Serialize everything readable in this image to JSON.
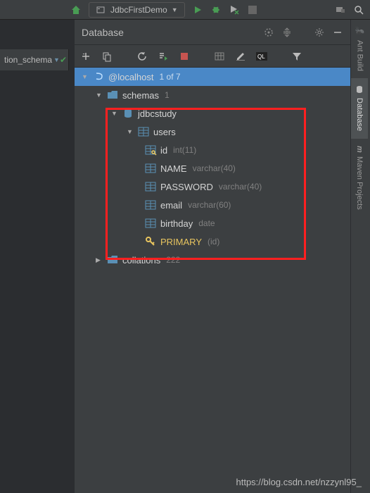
{
  "project_name": "JdbcFirstDemo",
  "left_stub": "tion_schema",
  "panel": {
    "title": "Database"
  },
  "root": {
    "label": "@localhost",
    "count": "1 of 7"
  },
  "schemas": {
    "label": "schemas",
    "count": "1"
  },
  "db": {
    "label": "jdbcstudy"
  },
  "table": {
    "label": "users"
  },
  "columns": [
    {
      "name": "id",
      "type": "int(11)",
      "pk": true
    },
    {
      "name": "NAME",
      "type": "varchar(40)",
      "pk": false
    },
    {
      "name": "PASSWORD",
      "type": "varchar(40)",
      "pk": false
    },
    {
      "name": "email",
      "type": "varchar(60)",
      "pk": false
    },
    {
      "name": "birthday",
      "type": "date",
      "pk": false
    }
  ],
  "primary": {
    "label": "PRIMARY",
    "ref": "(id)"
  },
  "collations": {
    "label": "collations",
    "count": "222"
  },
  "watermark": "https://blog.csdn.net/nzzynl95_",
  "side_tabs": [
    "Ant Build",
    "Database",
    "Maven Projects"
  ]
}
